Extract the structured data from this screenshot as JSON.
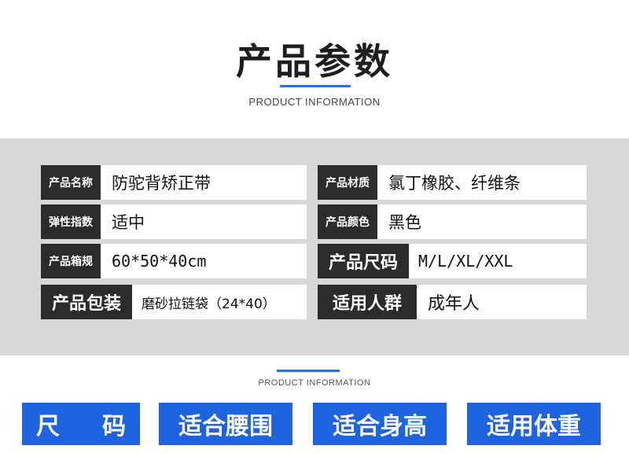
{
  "header": {
    "title": "产品参数",
    "subtitle": "PRODUCT INFORMATION"
  },
  "params": [
    {
      "label": "产品名称",
      "value": "防驼背矫正带"
    },
    {
      "label": "产品材质",
      "value": "氯丁橡胶、纤维条"
    },
    {
      "label": "弹性指数",
      "value": "适中"
    },
    {
      "label": "产品颜色",
      "value": "黑色"
    },
    {
      "label": "产品箱规",
      "value": "60*50*40cm"
    },
    {
      "label": "产品尺码",
      "value": "M/L/XL/XXL"
    },
    {
      "label": "产品包装",
      "value": "磨砂拉链袋（24*40）"
    },
    {
      "label": "适用人群",
      "value": "成年人"
    }
  ],
  "footer": {
    "subtitle": "PRODUCT INFORMATION"
  },
  "buttons": [
    {
      "label_left": "尺",
      "label_right": "码"
    },
    {
      "label": "适合腰围"
    },
    {
      "label": "适合身高"
    },
    {
      "label": "适用体重"
    }
  ],
  "colors": {
    "accent": "#1e63e0",
    "label_bg": "#2b2b2b",
    "panel_bg": "#d8d8d8"
  }
}
